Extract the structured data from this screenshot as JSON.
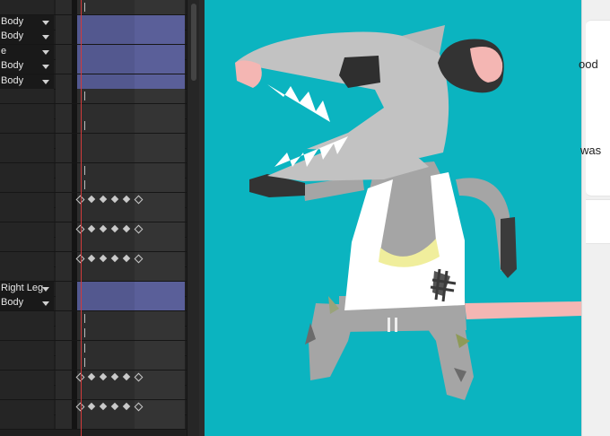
{
  "timeline": {
    "rows": [
      {
        "label": "",
        "layer": false,
        "marker": true,
        "keys": []
      },
      {
        "label": "Body",
        "layer": true,
        "marker": false,
        "keys": []
      },
      {
        "label": "Body",
        "layer": true,
        "marker": false,
        "keys": []
      },
      {
        "label": "e",
        "layer": true,
        "marker": false,
        "keys": []
      },
      {
        "label": "Body",
        "layer": true,
        "marker": false,
        "keys": []
      },
      {
        "label": "Body",
        "layer": true,
        "marker": false,
        "keys": []
      },
      {
        "label": "",
        "layer": false,
        "marker": true,
        "keys": []
      },
      {
        "label": "",
        "layer": false,
        "marker": false,
        "keys": []
      },
      {
        "label": "",
        "layer": false,
        "marker": true,
        "keys": []
      },
      {
        "label": "",
        "layer": false,
        "marker": false,
        "keys": []
      },
      {
        "label": "",
        "layer": false,
        "marker": false,
        "keys": []
      },
      {
        "label": "",
        "layer": false,
        "marker": true,
        "keys": []
      },
      {
        "label": "",
        "layer": false,
        "marker": true,
        "keys": []
      },
      {
        "label": "",
        "layer": false,
        "marker": false,
        "keys": [
          "o",
          "f",
          "f",
          "f",
          "f",
          "o"
        ]
      },
      {
        "label": "",
        "layer": false,
        "marker": false,
        "keys": []
      },
      {
        "label": "",
        "layer": false,
        "marker": false,
        "keys": [
          "o",
          "f",
          "f",
          "f",
          "f",
          "o"
        ]
      },
      {
        "label": "",
        "layer": false,
        "marker": false,
        "keys": []
      },
      {
        "label": "",
        "layer": false,
        "marker": false,
        "keys": [
          "o",
          "f",
          "f",
          "f",
          "f",
          "o"
        ]
      },
      {
        "label": "",
        "layer": false,
        "marker": false,
        "keys": []
      },
      {
        "label": "Right Leg",
        "layer": true,
        "marker": false,
        "keys": []
      },
      {
        "label": "Body",
        "layer": true,
        "marker": false,
        "keys": []
      },
      {
        "label": "",
        "layer": false,
        "marker": true,
        "keys": []
      },
      {
        "label": "",
        "layer": false,
        "marker": true,
        "keys": []
      },
      {
        "label": "",
        "layer": false,
        "marker": true,
        "keys": []
      },
      {
        "label": "",
        "layer": false,
        "marker": true,
        "keys": []
      },
      {
        "label": "",
        "layer": false,
        "marker": false,
        "keys": [
          "o",
          "f",
          "f",
          "f",
          "f",
          "o"
        ]
      },
      {
        "label": "",
        "layer": false,
        "marker": false,
        "keys": []
      },
      {
        "label": "",
        "layer": false,
        "marker": false,
        "keys": [
          "o",
          "f",
          "f",
          "f",
          "f",
          "o"
        ]
      },
      {
        "label": "",
        "layer": false,
        "marker": false,
        "keys": []
      }
    ]
  },
  "right_panel": {
    "text1": "ood",
    "text2": "was"
  },
  "stage": {
    "background": "#0bb4c0",
    "character": "rat-in-tank-top-icon"
  },
  "colors": {
    "layer_bar": "#53588f",
    "playhead": "#d23b3b"
  }
}
